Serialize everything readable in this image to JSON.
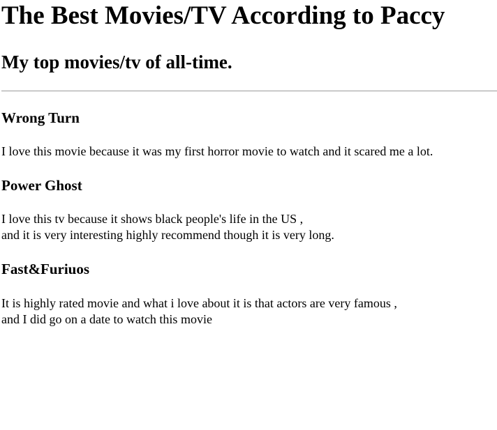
{
  "page": {
    "title": "The Best Movies/TV According to Paccy",
    "subtitle": "My top movies/tv of all-time."
  },
  "entries": [
    {
      "title": "Wrong Turn",
      "lines": [
        "I love this movie because it was my first horror movie to watch and it scared me a lot."
      ]
    },
    {
      "title": "Power Ghost",
      "lines": [
        "I love this tv because it shows black people's life in the US ,",
        "and it is very interesting highly recommend though it is very long."
      ]
    },
    {
      "title": "Fast&Furiuos",
      "lines": [
        "It is highly rated movie and what i love about it is that actors are very famous ,",
        "and I did go on a date to watch this movie"
      ]
    }
  ]
}
